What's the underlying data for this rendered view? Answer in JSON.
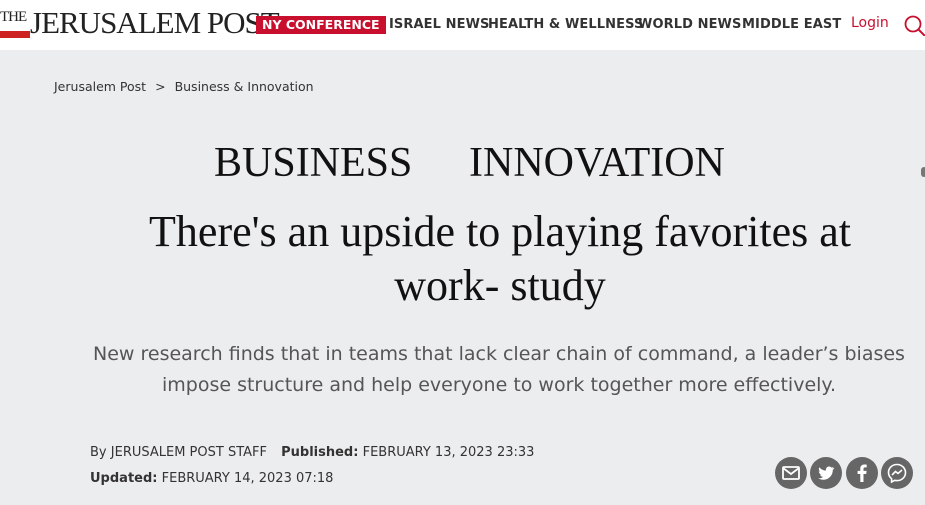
{
  "header": {
    "logo_the": "THE",
    "logo_name": "JERUSALEM POST",
    "nav_badge": "NY CONFERENCE",
    "nav": [
      "ISRAEL NEWS",
      "HEALTH & WELLNESS",
      "WORLD NEWS",
      "MIDDLE EAST"
    ],
    "login": "Login"
  },
  "breadcrumb": {
    "home": "Jerusalem Post",
    "separator": ">",
    "section": "Business & Innovation"
  },
  "section_logo": {
    "left": "BUSINESS",
    "right": "INNOVATION",
    "brand_color": "#d62839"
  },
  "article": {
    "headline_line1": "There's an upside to playing favorites at",
    "headline_line2": "work- study",
    "subhead_line1": "New research finds that in teams that lack clear chain of command, a leader’s biases",
    "subhead_line2": "impose structure and help everyone to work together more effectively.",
    "by_prefix": "By",
    "author": "JERUSALEM POST STAFF",
    "published_label": "Published:",
    "published": "FEBRUARY 13, 2023 23:33",
    "updated_label": "Updated:",
    "updated": "FEBRUARY 14, 2023 07:18"
  },
  "share_icons": [
    "mail-icon",
    "twitter-icon",
    "facebook-icon",
    "messenger-icon"
  ],
  "colors": {
    "accent": "#c8102e",
    "background": "#ecedee",
    "share": "#666666"
  }
}
